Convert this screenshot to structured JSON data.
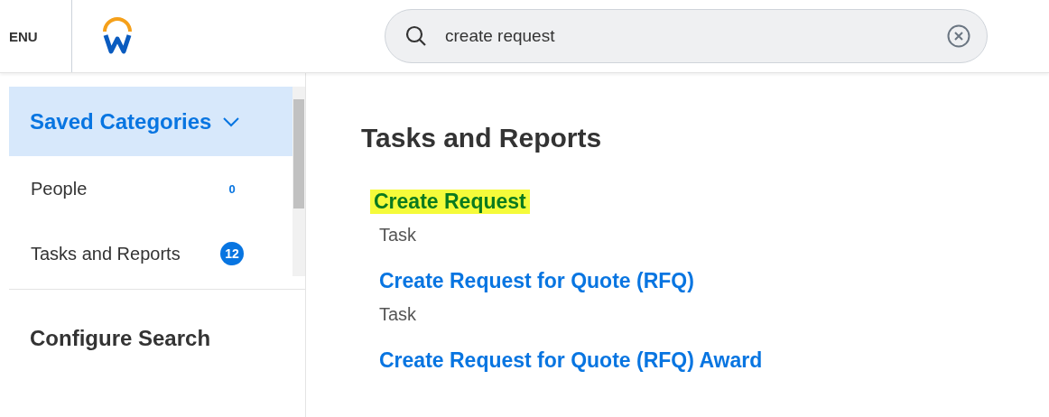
{
  "header": {
    "menu_label": "ENU",
    "search": {
      "value": "create request"
    }
  },
  "sidebar": {
    "section": {
      "title": "Saved Categories",
      "expanded": true
    },
    "items": [
      {
        "label": "People",
        "count": "0",
        "kind": "plain"
      },
      {
        "label": "Tasks and Reports",
        "count": "12",
        "kind": "pill"
      }
    ],
    "configure_label": "Configure Search"
  },
  "results": {
    "heading": "Tasks and Reports",
    "items": [
      {
        "title": "Create Request",
        "subtitle": "Task",
        "highlighted": true
      },
      {
        "title": "Create Request for Quote (RFQ)",
        "subtitle": "Task",
        "highlighted": false
      },
      {
        "title": "Create Request for Quote (RFQ) Award",
        "highlighted": false
      }
    ]
  }
}
